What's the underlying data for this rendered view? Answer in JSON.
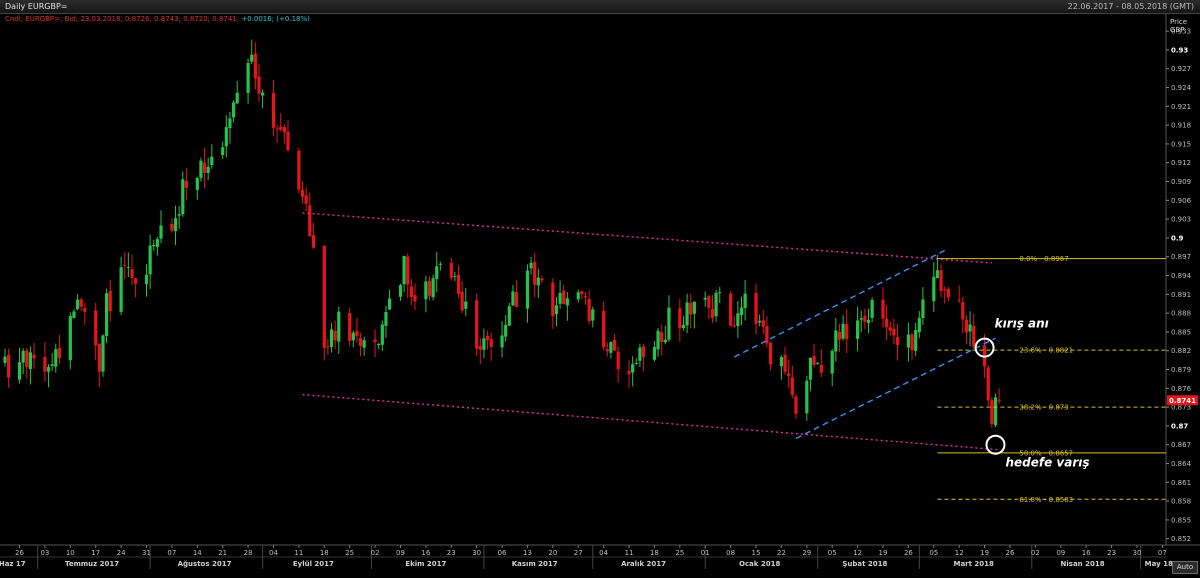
{
  "window": {
    "title": "Daily EURGBP=",
    "date_range": "22.06.2017 - 08.05.2018 (GMT)"
  },
  "info_line": {
    "ohlc": "Cndl; EURGBP=; Bid; 23.03.2018; 0.8726; 0.8743; 0.8720; 0.8741;",
    "change": "+0.0016; (+0.18%)"
  },
  "axis": {
    "title_line1": "Price",
    "title_line2": "GBP",
    "auto_label": "Auto"
  },
  "colors": {
    "up": "#27c24c",
    "down": "#e8141c",
    "fib": "#d8c020",
    "channel_pink": "#e0309c",
    "channel_blue": "#3a8ef0",
    "last_price_bg": "#e8141c"
  },
  "chart_data": {
    "type": "candlestick",
    "instrument": "EURGBP=",
    "interval": "Daily",
    "ylim": [
      0.851,
      0.9335
    ],
    "y_ticks": [
      0.852,
      0.855,
      0.858,
      0.861,
      0.864,
      0.867,
      0.87,
      0.873,
      0.876,
      0.879,
      0.882,
      0.885,
      0.888,
      0.891,
      0.894,
      0.897,
      0.9,
      0.903,
      0.906,
      0.909,
      0.912,
      0.915,
      0.918,
      0.921,
      0.924,
      0.927,
      0.93,
      0.933
    ],
    "y_ticks_bold": [
      0.87,
      0.9,
      0.93
    ],
    "x_start": "2017-06-22",
    "x_end": "2018-05-08",
    "day_ticks": [
      {
        "date": "2017-06-26",
        "label": "26"
      },
      {
        "date": "2017-07-03",
        "label": "03"
      },
      {
        "date": "2017-07-10",
        "label": "10"
      },
      {
        "date": "2017-07-17",
        "label": "17"
      },
      {
        "date": "2017-07-24",
        "label": "24"
      },
      {
        "date": "2017-07-31",
        "label": "31"
      },
      {
        "date": "2017-08-07",
        "label": "07"
      },
      {
        "date": "2017-08-14",
        "label": "14"
      },
      {
        "date": "2017-08-21",
        "label": "21"
      },
      {
        "date": "2017-08-28",
        "label": "28"
      },
      {
        "date": "2017-09-04",
        "label": "04"
      },
      {
        "date": "2017-09-11",
        "label": "11"
      },
      {
        "date": "2017-09-18",
        "label": "18"
      },
      {
        "date": "2017-09-25",
        "label": "25"
      },
      {
        "date": "2017-10-02",
        "label": "02"
      },
      {
        "date": "2017-10-09",
        "label": "09"
      },
      {
        "date": "2017-10-16",
        "label": "16"
      },
      {
        "date": "2017-10-23",
        "label": "23"
      },
      {
        "date": "2017-10-30",
        "label": "30"
      },
      {
        "date": "2017-11-06",
        "label": "06"
      },
      {
        "date": "2017-11-13",
        "label": "13"
      },
      {
        "date": "2017-11-20",
        "label": "20"
      },
      {
        "date": "2017-11-27",
        "label": "27"
      },
      {
        "date": "2017-12-04",
        "label": "04"
      },
      {
        "date": "2017-12-11",
        "label": "11"
      },
      {
        "date": "2017-12-18",
        "label": "18"
      },
      {
        "date": "2017-12-25",
        "label": "25"
      },
      {
        "date": "2018-01-01",
        "label": "01"
      },
      {
        "date": "2018-01-08",
        "label": "08"
      },
      {
        "date": "2018-01-15",
        "label": "15"
      },
      {
        "date": "2018-01-22",
        "label": "22"
      },
      {
        "date": "2018-01-29",
        "label": "29"
      },
      {
        "date": "2018-02-05",
        "label": "05"
      },
      {
        "date": "2018-02-12",
        "label": "12"
      },
      {
        "date": "2018-02-19",
        "label": "19"
      },
      {
        "date": "2018-02-26",
        "label": "26"
      },
      {
        "date": "2018-03-05",
        "label": "05"
      },
      {
        "date": "2018-03-12",
        "label": "12"
      },
      {
        "date": "2018-03-19",
        "label": "19"
      },
      {
        "date": "2018-03-26",
        "label": "26"
      },
      {
        "date": "2018-04-02",
        "label": "02"
      },
      {
        "date": "2018-04-09",
        "label": "09"
      },
      {
        "date": "2018-04-16",
        "label": "16"
      },
      {
        "date": "2018-04-23",
        "label": "23"
      },
      {
        "date": "2018-04-30",
        "label": "30"
      },
      {
        "date": "2018-05-07",
        "label": "07"
      }
    ],
    "month_ticks": [
      {
        "date": "2017-06-24",
        "label": "Haz 17"
      },
      {
        "date": "2017-07-16",
        "label": "Temmuz 2017"
      },
      {
        "date": "2017-08-16",
        "label": "Ağustos 2017"
      },
      {
        "date": "2017-09-15",
        "label": "Eylül 2017"
      },
      {
        "date": "2017-10-16",
        "label": "Ekim 2017"
      },
      {
        "date": "2017-11-15",
        "label": "Kasım 2017"
      },
      {
        "date": "2017-12-15",
        "label": "Aralık 2017"
      },
      {
        "date": "2018-01-16",
        "label": "Ocak 2018"
      },
      {
        "date": "2018-02-14",
        "label": "Şubat 2018"
      },
      {
        "date": "2018-03-16",
        "label": "Mart 2018"
      },
      {
        "date": "2018-04-15",
        "label": "Nisan 2018"
      },
      {
        "date": "2018-05-06",
        "label": "May 18"
      }
    ],
    "month_separators": [
      "2017-07-01",
      "2017-08-01",
      "2017-09-01",
      "2017-10-01",
      "2017-11-01",
      "2017-12-01",
      "2018-01-01",
      "2018-02-01",
      "2018-03-01",
      "2018-04-01",
      "2018-05-01"
    ],
    "close_anchors": [
      [
        "2017-06-22",
        0.88
      ],
      [
        "2017-06-26",
        0.879
      ],
      [
        "2017-06-29",
        0.8815
      ],
      [
        "2017-07-03",
        0.8775
      ],
      [
        "2017-07-07",
        0.881
      ],
      [
        "2017-07-11",
        0.888
      ],
      [
        "2017-07-14",
        0.89
      ],
      [
        "2017-07-18",
        0.878
      ],
      [
        "2017-07-20",
        0.889
      ],
      [
        "2017-07-25",
        0.896
      ],
      [
        "2017-07-28",
        0.893
      ],
      [
        "2017-08-01",
        0.897
      ],
      [
        "2017-08-04",
        0.901
      ],
      [
        "2017-08-08",
        0.904
      ],
      [
        "2017-08-10",
        0.908
      ],
      [
        "2017-08-14",
        0.911
      ],
      [
        "2017-08-17",
        0.913
      ],
      [
        "2017-08-21",
        0.915
      ],
      [
        "2017-08-24",
        0.921
      ],
      [
        "2017-08-28",
        0.926
      ],
      [
        "2017-08-29",
        0.928
      ],
      [
        "2017-09-01",
        0.921
      ],
      [
        "2017-09-04",
        0.917
      ],
      [
        "2017-09-07",
        0.918
      ],
      [
        "2017-09-12",
        0.907
      ],
      [
        "2017-09-14",
        0.902
      ],
      [
        "2017-09-18",
        0.884
      ],
      [
        "2017-09-22",
        0.886
      ],
      [
        "2017-09-26",
        0.883
      ],
      [
        "2017-09-29",
        0.8815
      ],
      [
        "2017-10-03",
        0.884
      ],
      [
        "2017-10-06",
        0.892
      ],
      [
        "2017-10-10",
        0.895
      ],
      [
        "2017-10-13",
        0.89
      ],
      [
        "2017-10-17",
        0.893
      ],
      [
        "2017-10-20",
        0.896
      ],
      [
        "2017-10-24",
        0.892
      ],
      [
        "2017-10-27",
        0.888
      ],
      [
        "2017-10-31",
        0.882
      ],
      [
        "2017-11-03",
        0.884
      ],
      [
        "2017-11-08",
        0.888
      ],
      [
        "2017-11-13",
        0.895
      ],
      [
        "2017-11-16",
        0.892
      ],
      [
        "2017-11-20",
        0.888
      ],
      [
        "2017-11-23",
        0.89
      ],
      [
        "2017-11-28",
        0.892
      ],
      [
        "2017-12-01",
        0.887
      ],
      [
        "2017-12-05",
        0.884
      ],
      [
        "2017-12-08",
        0.878
      ],
      [
        "2017-12-12",
        0.881
      ],
      [
        "2017-12-15",
        0.88
      ],
      [
        "2017-12-19",
        0.883
      ],
      [
        "2017-12-22",
        0.887
      ],
      [
        "2017-12-27",
        0.888
      ],
      [
        "2018-01-02",
        0.889
      ],
      [
        "2018-01-05",
        0.89
      ],
      [
        "2018-01-09",
        0.887
      ],
      [
        "2018-01-12",
        0.889
      ],
      [
        "2018-01-16",
        0.885
      ],
      [
        "2018-01-19",
        0.882
      ],
      [
        "2018-01-23",
        0.878
      ],
      [
        "2018-01-26",
        0.872
      ],
      [
        "2018-01-30",
        0.88
      ],
      [
        "2018-02-02",
        0.878
      ],
      [
        "2018-02-06",
        0.883
      ],
      [
        "2018-02-09",
        0.886
      ],
      [
        "2018-02-13",
        0.889
      ],
      [
        "2018-02-16",
        0.888
      ],
      [
        "2018-02-20",
        0.885
      ],
      [
        "2018-02-23",
        0.882
      ],
      [
        "2018-02-27",
        0.883
      ],
      [
        "2018-03-02",
        0.89
      ],
      [
        "2018-03-06",
        0.894
      ],
      [
        "2018-03-09",
        0.892
      ],
      [
        "2018-03-13",
        0.888
      ],
      [
        "2018-03-15",
        0.885
      ],
      [
        "2018-03-19",
        0.88
      ],
      [
        "2018-03-20",
        0.876
      ],
      [
        "2018-03-21",
        0.872
      ],
      [
        "2018-03-22",
        0.8725
      ],
      [
        "2018-03-23",
        0.8741
      ]
    ],
    "last_price": 0.8741,
    "last_price_label": "0.8741",
    "fibonacci": [
      {
        "label": "0.0% - 0.8967",
        "value": 0.8967,
        "dashed": false
      },
      {
        "label": "23.6% - 0.8821",
        "value": 0.8821,
        "dashed": true
      },
      {
        "label": "38.2% - 0.873",
        "value": 0.873,
        "dashed": true
      },
      {
        "label": "50.0% - 0.8657",
        "value": 0.8657,
        "dashed": false
      },
      {
        "label": "61.8% - 0.8583",
        "value": 0.8583,
        "dashed": true
      }
    ],
    "fib_start": "2018-03-06",
    "channel_pink": {
      "upper": [
        [
          "2017-09-12",
          0.904
        ],
        [
          "2018-03-21",
          0.896
        ]
      ],
      "lower": [
        [
          "2017-09-12",
          0.875
        ],
        [
          "2018-03-23",
          0.8662
        ]
      ]
    },
    "channel_blue": {
      "upper": [
        [
          "2018-01-09",
          0.881
        ],
        [
          "2018-03-08",
          0.898
        ]
      ],
      "lower": [
        [
          "2018-01-26",
          0.868
        ],
        [
          "2018-03-22",
          0.884
        ]
      ]
    },
    "markers": [
      {
        "date": "2018-03-19",
        "value": 0.8825,
        "label": "kırış anı"
      },
      {
        "date": "2018-03-22",
        "value": 0.867,
        "label": "hedefe varış"
      }
    ]
  }
}
